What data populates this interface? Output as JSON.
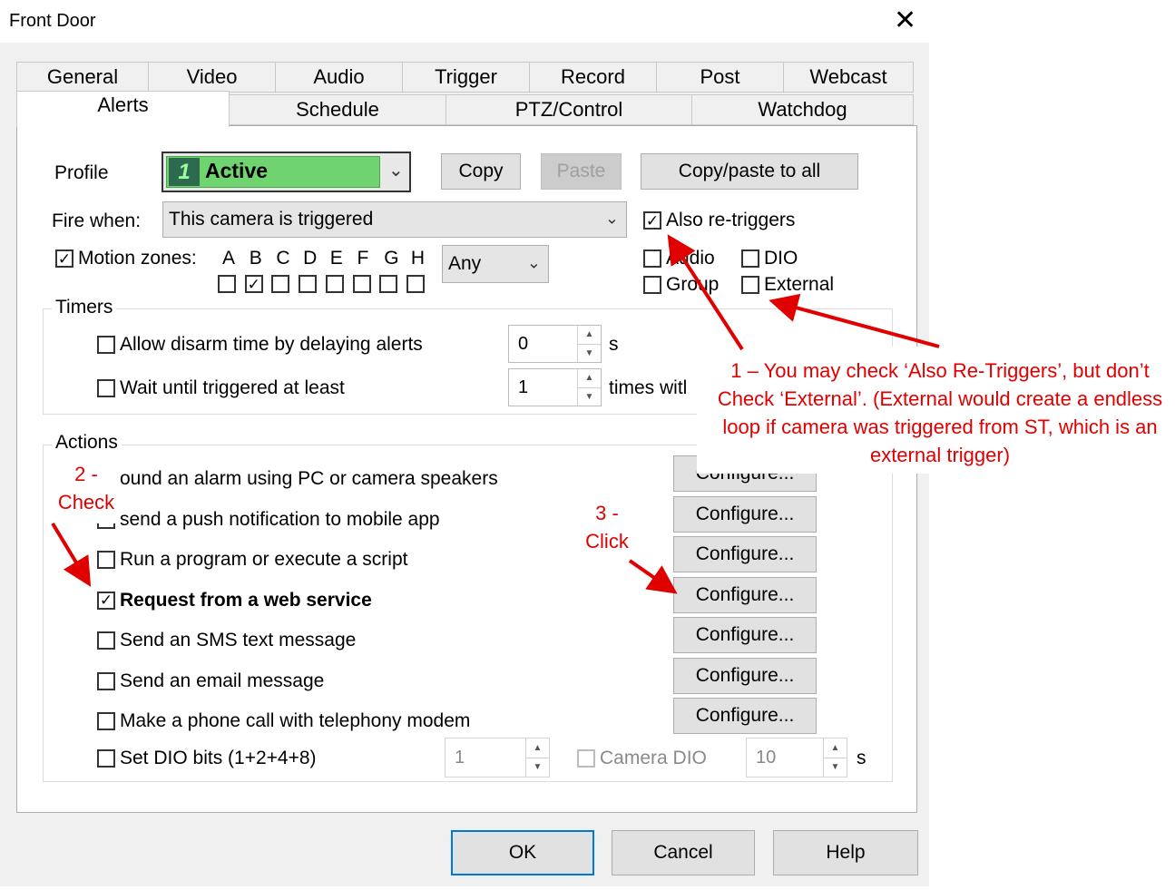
{
  "window": {
    "title": "Front Door",
    "close_glyph": "✕"
  },
  "tabs": {
    "row1": [
      "General",
      "Video",
      "Audio",
      "Trigger",
      "Record",
      "Post",
      "Webcast"
    ],
    "row2": [
      "Alerts",
      "Schedule",
      "PTZ/Control",
      "Watchdog"
    ],
    "active": "Alerts"
  },
  "profile": {
    "label": "Profile",
    "value": "Active",
    "badge": "1",
    "color": "#6fd36f",
    "copy": "Copy",
    "paste": "Paste",
    "copy_paste_all": "Copy/paste to all"
  },
  "fire_when": {
    "label": "Fire when:",
    "value": "This camera is triggered",
    "also_retriggers": "Also re-triggers",
    "audio": "Audio",
    "dio": "DIO",
    "group": "Group",
    "external": "External"
  },
  "motion_zones": {
    "label": "Motion zones:",
    "zones": [
      "A",
      "B",
      "C",
      "D",
      "E",
      "F",
      "G",
      "H"
    ],
    "checked": [
      false,
      true,
      false,
      false,
      false,
      false,
      false,
      false
    ],
    "any": "Any"
  },
  "timers": {
    "title": "Timers",
    "disarm_label": "Allow disarm time by delaying alerts",
    "disarm_value": "0",
    "disarm_unit": "s",
    "wait_label": "Wait until triggered at least",
    "wait_value": "1",
    "wait_unit": "times witl"
  },
  "actions": {
    "title": "Actions",
    "items": [
      {
        "label": "ound an alarm using PC or camera speakers",
        "checked": false,
        "button": "Configure..."
      },
      {
        "label": "send a push notification to mobile app",
        "checked": false,
        "button": "Configure..."
      },
      {
        "label": "Run a program or execute a script",
        "checked": false,
        "button": "Configure..."
      },
      {
        "label": "Request from a web service",
        "checked": true,
        "button": "Configure..."
      },
      {
        "label": "Send an SMS text message",
        "checked": false,
        "button": "Configure..."
      },
      {
        "label": "Send an email message",
        "checked": false,
        "button": "Configure..."
      },
      {
        "label": "Make a phone call with telephony modem",
        "checked": false,
        "button": "Configure..."
      }
    ],
    "dio_label": "Set DIO bits (1+2+4+8)",
    "dio_value": "1",
    "camera_dio": "Camera DIO",
    "camera_dio_value": "10",
    "camera_dio_unit": "s"
  },
  "footer": {
    "ok": "OK",
    "cancel": "Cancel",
    "help": "Help"
  },
  "annotations": {
    "note1": "1 – You may  check ‘Also Re-Triggers’, but don’t Check ‘External’. (External would create a endless loop if camera was triggered from ST, which is an external trigger)",
    "note2": "2 -\nCheck",
    "note3": "3 -\nClick",
    "color": "#e00000"
  },
  "icons": {
    "check": "✓",
    "chevron": "⌄"
  }
}
